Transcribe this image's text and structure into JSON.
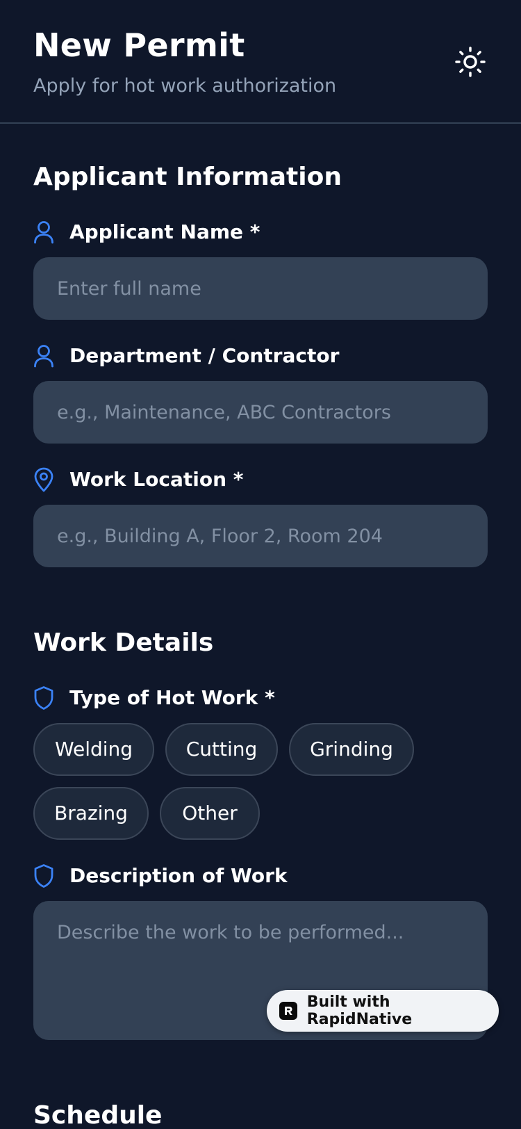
{
  "header": {
    "title": "New Permit",
    "subtitle": "Apply for hot work authorization",
    "theme_icon": "sun-icon"
  },
  "applicant_section": {
    "title": "Applicant Information",
    "fields": [
      {
        "label": "Applicant Name *",
        "placeholder": "Enter full name",
        "value": "",
        "icon": "user-icon"
      },
      {
        "label": "Department / Contractor",
        "placeholder": "e.g., Maintenance, ABC Contractors",
        "value": "",
        "icon": "user-icon"
      },
      {
        "label": "Work Location *",
        "placeholder": "e.g., Building A, Floor 2, Room 204",
        "value": "",
        "icon": "map-pin-icon"
      }
    ]
  },
  "work_section": {
    "title": "Work Details",
    "type_label": "Type of Hot Work *",
    "type_icon": "shield-icon",
    "types": [
      "Welding",
      "Cutting",
      "Grinding",
      "Brazing",
      "Other"
    ],
    "description_label": "Description of Work",
    "description_icon": "shield-icon",
    "description_placeholder": "Describe the work to be performed..."
  },
  "schedule_section": {
    "title": "Schedule"
  },
  "badge": {
    "label": "Built with RapidNative"
  },
  "colors": {
    "background": "#0f172a",
    "input_bg": "#334155",
    "chip_bg": "#1e293b",
    "accent": "#3b82f6",
    "muted_text": "#94a3b8"
  }
}
